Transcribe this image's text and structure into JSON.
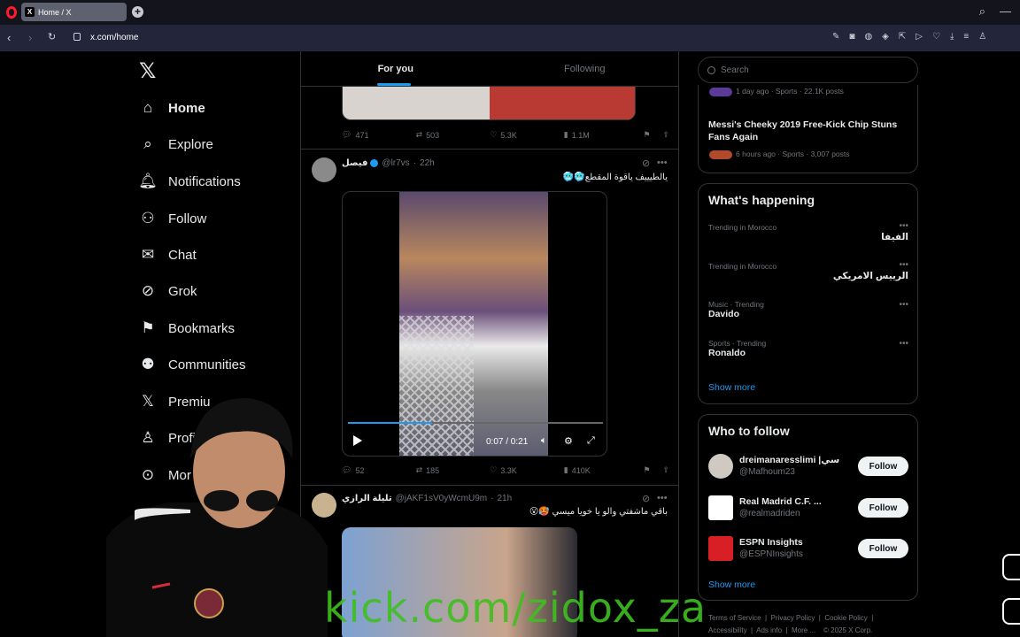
{
  "browser": {
    "tab_title": "Home / X",
    "url": "x.com/home"
  },
  "nav": {
    "items": [
      {
        "label": "Home",
        "icon": "home-icon"
      },
      {
        "label": "Explore",
        "icon": "search-icon"
      },
      {
        "label": "Notifications",
        "icon": "bell-icon"
      },
      {
        "label": "Follow",
        "icon": "add-person-icon"
      },
      {
        "label": "Chat",
        "icon": "mail-icon"
      },
      {
        "label": "Grok",
        "icon": "grok-icon"
      },
      {
        "label": "Bookmarks",
        "icon": "bookmark-icon"
      },
      {
        "label": "Communities",
        "icon": "people-icon"
      },
      {
        "label": "Premiu",
        "icon": "x-icon"
      },
      {
        "label": "Profil",
        "icon": "person-icon"
      },
      {
        "label": "Mor",
        "icon": "more-circle-icon"
      }
    ]
  },
  "timeline": {
    "tabs": [
      "For you",
      "Following"
    ],
    "post0": {
      "replies": "471",
      "reposts": "503",
      "likes": "5.3K",
      "views": "1.1M"
    },
    "post1": {
      "name": "فيصل",
      "handle": "@lr7vs",
      "time": "22h",
      "text": "يالطيييف ياقوة المقطع🥶🥶",
      "video_time": "0:07 / 0:21",
      "video_progress": 0.33,
      "replies": "52",
      "reposts": "185",
      "likes": "3.3K",
      "views": "410K"
    },
    "post2": {
      "name": "تليلة الرازي",
      "handle": "@jAKF1sV0yWcmU9m",
      "time": "21h",
      "text": "باقي ماشفتي والو يا خويا ميسي 🥵😮"
    }
  },
  "right": {
    "search_placeholder": "Search",
    "trend_top": {
      "meta1": "1 day ago · Sports · 22.1K posts",
      "headline": "Messi's Cheeky 2019 Free-Kick Chip Stuns Fans Again",
      "meta2": "6 hours ago · Sports · 3,007 posts"
    },
    "happening": {
      "title": "What's happening",
      "trends": [
        {
          "meta": "Trending in Morocco",
          "name": "الفيفا"
        },
        {
          "meta": "Trending in Morocco",
          "name": "الرييس الامريكي"
        },
        {
          "meta": "Music · Trending",
          "name": "Davido"
        },
        {
          "meta": "Sports · Trending",
          "name": "Ronaldo"
        }
      ],
      "show_more": "Show more"
    },
    "who_to_follow": {
      "title": "Who to follow",
      "accounts": [
        {
          "name": "dreimanaresslimi |سي",
          "handle": "@Mafhoum23"
        },
        {
          "name": "Real Madrid C.F. ...",
          "handle": "@realmadriden"
        },
        {
          "name": "ESPN Insights",
          "handle": "@ESPNInsights"
        }
      ],
      "follow_label": "Follow",
      "show_more": "Show more"
    },
    "footer": {
      "line1": [
        "Terms of Service",
        "Privacy Policy",
        "Cookie Policy"
      ],
      "line2": [
        "Accessibility",
        "Ads info",
        "More ...",
        "© 2025 X Corp."
      ]
    }
  },
  "overlay": {
    "watermark": "kick.com/zidox_za"
  }
}
